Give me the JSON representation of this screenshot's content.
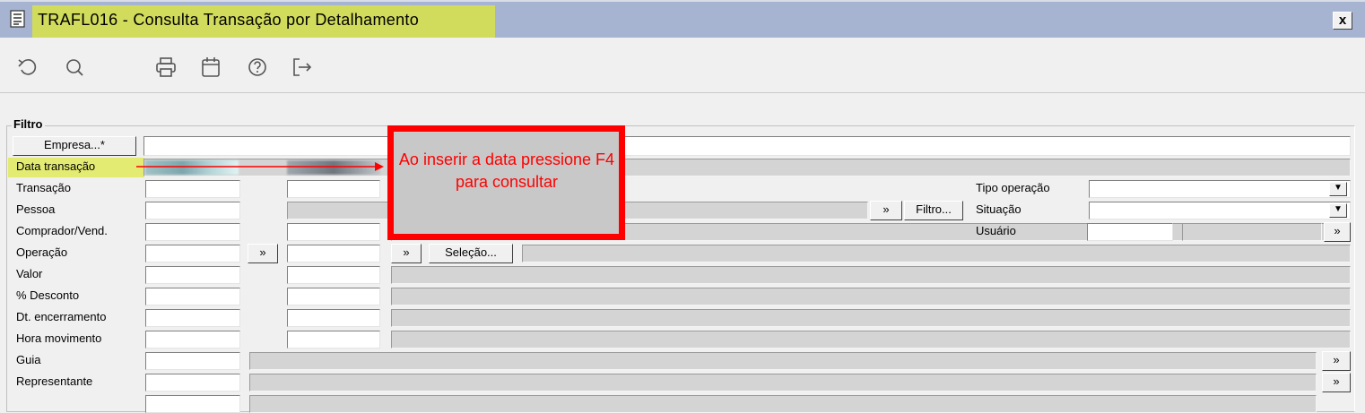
{
  "window": {
    "title": "TRAFL016 - Consulta Transação por Detalhamento",
    "close_label": "x"
  },
  "toolbar": {
    "buttons": [
      "undo-icon",
      "search-icon",
      "print-icon",
      "calendar-icon",
      "help-icon",
      "exit-icon"
    ]
  },
  "filter": {
    "legend": "Filtro",
    "empresa_button": "Empresa...*",
    "empresa_value": "",
    "labels": {
      "data_transacao": "Data transação",
      "transacao": "Transação",
      "pessoa": "Pessoa",
      "comprador": "Comprador/Vend.",
      "operacao": "Operação",
      "valor": "Valor",
      "desconto": "% Desconto",
      "dt_encerramento": "Dt. encerramento",
      "hora_movimento": "Hora movimento",
      "guia": "Guia",
      "representante": "Representante"
    },
    "right_labels": {
      "tipo_operacao": "Tipo operação",
      "situacao": "Situação",
      "usuario": "Usuário"
    },
    "buttons": {
      "more": "»",
      "filtro": "Filtro...",
      "selecao": "Seleção...",
      "dropdown": "▼"
    }
  },
  "annotation": {
    "text": "Ao inserir a data pressione F4 para consultar",
    "color": "#ff0000",
    "highlight": "#e4eb72"
  }
}
